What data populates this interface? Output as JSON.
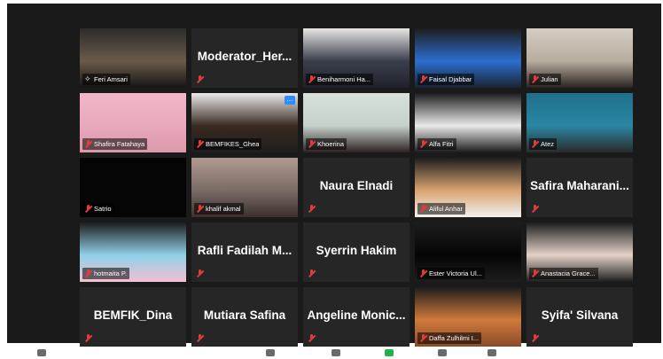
{
  "meeting": {
    "participants": [
      {
        "name": "Feri Amsari",
        "type": "video",
        "active": true,
        "pinned": true,
        "video_colors": [
          "#2c2c2c",
          "#6b5a49",
          "#151515"
        ]
      },
      {
        "name": "Moderator_Her...",
        "type": "name",
        "nameplate": ""
      },
      {
        "name": "Beniharmoni Ha...",
        "type": "video",
        "video_colors": [
          "#e8e6e4",
          "#3a3f4c",
          "#1f222a"
        ]
      },
      {
        "name": "Faisal Djabbar",
        "type": "video",
        "video_colors": [
          "#1d1d1d",
          "#2b6fcf",
          "#1a2333"
        ]
      },
      {
        "name": "Julian",
        "type": "video",
        "video_colors": [
          "#d4cdc2",
          "#b8ad9f",
          "#2a2420"
        ]
      },
      {
        "name": "Shafira Fatahaya",
        "type": "video",
        "video_colors": [
          "#f1b6c8",
          "#e9a8bd",
          "#d99aa9"
        ]
      },
      {
        "name": "BEMFIKES_Ghea",
        "type": "video",
        "video_colors": [
          "#eaeaea",
          "#3a2a22",
          "#1e1e1e"
        ],
        "more": true
      },
      {
        "name": "Khoerina",
        "type": "video",
        "video_colors": [
          "#d7e1d8",
          "#c6d1cc",
          "#2b2220"
        ]
      },
      {
        "name": "Alfa Fitri",
        "type": "video",
        "video_colors": [
          "#1d1d1d",
          "#e9e9e9",
          "#1b1b1b"
        ]
      },
      {
        "name": "Atez",
        "type": "video",
        "video_colors": [
          "#1f6f8a",
          "#2a86a3",
          "#2a2a2a"
        ]
      },
      {
        "name": "Satrio",
        "type": "video",
        "video_colors": [
          "#050505",
          "#050505",
          "#050505"
        ]
      },
      {
        "name": "khalif akmal",
        "type": "video",
        "video_colors": [
          "#b09a90",
          "#7a6b66",
          "#3b302e"
        ]
      },
      {
        "name": "Naura Elnadi",
        "type": "name",
        "nameplate": ""
      },
      {
        "name": "Aliful Anhar",
        "type": "video",
        "video_colors": [
          "#1d1d1d",
          "#d9a470",
          "#f1f1f1"
        ]
      },
      {
        "name": "Safira  Maharani...",
        "type": "name",
        "nameplate": ""
      },
      {
        "name": "hotmaita P.",
        "type": "video",
        "video_colors": [
          "#1d1d1d",
          "#8fd0e8",
          "#f2c1d2"
        ]
      },
      {
        "name": "Rafli Fadilah M...",
        "type": "name",
        "nameplate": ""
      },
      {
        "name": "Syerrin Hakim",
        "type": "name",
        "nameplate": ""
      },
      {
        "name": "Ester Victoria Ul...",
        "type": "video",
        "video_colors": [
          "#1d1d1d",
          "#050505",
          "#1d1d1d"
        ]
      },
      {
        "name": "Anastacia Grace...",
        "type": "video",
        "video_colors": [
          "#1d1d1d",
          "#e4d2c8",
          "#1d1d1d"
        ]
      },
      {
        "name": "BEMFIK_Dina",
        "type": "name",
        "nameplate": ""
      },
      {
        "name": "Mutiara Safina",
        "type": "name",
        "nameplate": ""
      },
      {
        "name": "Angeline  Monic...",
        "type": "name",
        "nameplate": ""
      },
      {
        "name": "Daffa Zulhilmi I...",
        "type": "video",
        "video_colors": [
          "#1d1d1d",
          "#d07a3a",
          "#8a4a2a"
        ]
      },
      {
        "name": "Syifa' Silvana",
        "type": "name",
        "nameplate": ""
      }
    ]
  }
}
